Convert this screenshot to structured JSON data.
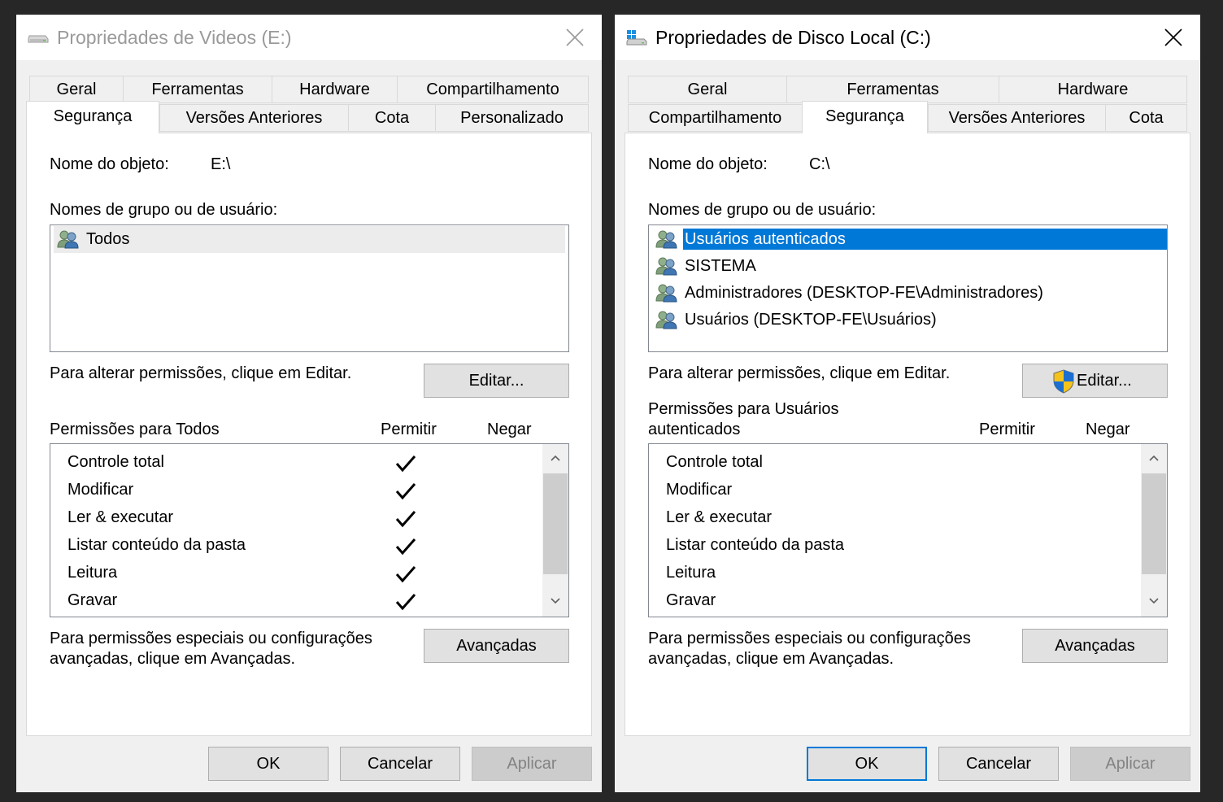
{
  "left_dialog": {
    "title": "Propriedades de Videos (E:)",
    "title_icon": "drive-icon",
    "close_icon": "close-icon",
    "tabs_row1": [
      "Geral",
      "Ferramentas",
      "Hardware",
      "Compartilhamento"
    ],
    "tabs_row2": [
      "Segurança",
      "Versões Anteriores",
      "Cota",
      "Personalizado"
    ],
    "selected_tab": "Segurança",
    "object_label": "Nome do objeto:",
    "object_value": "E:\\",
    "groups_label": "Nomes de grupo ou de usuário:",
    "groups": [
      "Todos"
    ],
    "change_text": "Para alterar permissões, clique em Editar.",
    "edit_button": "Editar...",
    "perm_label": "Permissões para Todos",
    "allow_header": "Permitir",
    "deny_header": "Negar",
    "permissions": [
      {
        "name": "Controle total",
        "allow": true,
        "deny": false
      },
      {
        "name": "Modificar",
        "allow": true,
        "deny": false
      },
      {
        "name": "Ler & executar",
        "allow": true,
        "deny": false
      },
      {
        "name": "Listar conteúdo da pasta",
        "allow": true,
        "deny": false
      },
      {
        "name": "Leitura",
        "allow": true,
        "deny": false
      },
      {
        "name": "Gravar",
        "allow": true,
        "deny": false
      }
    ],
    "advanced_text_1": "Para permissões especiais ou configurações",
    "advanced_text_2": "avançadas, clique em Avançadas.",
    "advanced_button": "Avançadas",
    "ok": "OK",
    "cancel": "Cancelar",
    "apply": "Aplicar"
  },
  "right_dialog": {
    "title": "Propriedades de Disco Local (C:)",
    "title_icon": "windows-drive-icon",
    "close_icon": "close-icon",
    "tabs_row1": [
      "Geral",
      "Ferramentas",
      "Hardware"
    ],
    "tabs_row2": [
      "Compartilhamento",
      "Segurança",
      "Versões Anteriores",
      "Cota"
    ],
    "selected_tab": "Segurança",
    "object_label": "Nome do objeto:",
    "object_value": "C:\\",
    "groups_label": "Nomes de grupo ou de usuário:",
    "groups": [
      "Usuários autenticados",
      "SISTEMA",
      "Administradores (DESKTOP-FE\\Administradores)",
      "Usuários (DESKTOP-FE\\Usuários)"
    ],
    "selected_group": "Usuários autenticados",
    "change_text": "Para alterar permissões, clique em Editar.",
    "edit_button": "Editar...",
    "edit_icon": "uac-shield-icon",
    "perm_label_1": "Permissões para Usuários",
    "perm_label_2": "autenticados",
    "allow_header": "Permitir",
    "deny_header": "Negar",
    "permissions": [
      {
        "name": "Controle total",
        "allow": false,
        "deny": false
      },
      {
        "name": "Modificar",
        "allow": false,
        "deny": false
      },
      {
        "name": "Ler & executar",
        "allow": false,
        "deny": false
      },
      {
        "name": "Listar conteúdo da pasta",
        "allow": false,
        "deny": false
      },
      {
        "name": "Leitura",
        "allow": false,
        "deny": false
      },
      {
        "name": "Gravar",
        "allow": false,
        "deny": false
      }
    ],
    "advanced_text_1": "Para permissões especiais ou configurações",
    "advanced_text_2": "avançadas, clique em Avançadas.",
    "advanced_button": "Avançadas",
    "ok": "OK",
    "cancel": "Cancelar",
    "apply": "Aplicar"
  },
  "colors": {
    "selection": "#0078d7",
    "dialog_bg": "#f0f0f0",
    "button_bg": "#e1e1e1",
    "disabled_text": "#838383"
  }
}
